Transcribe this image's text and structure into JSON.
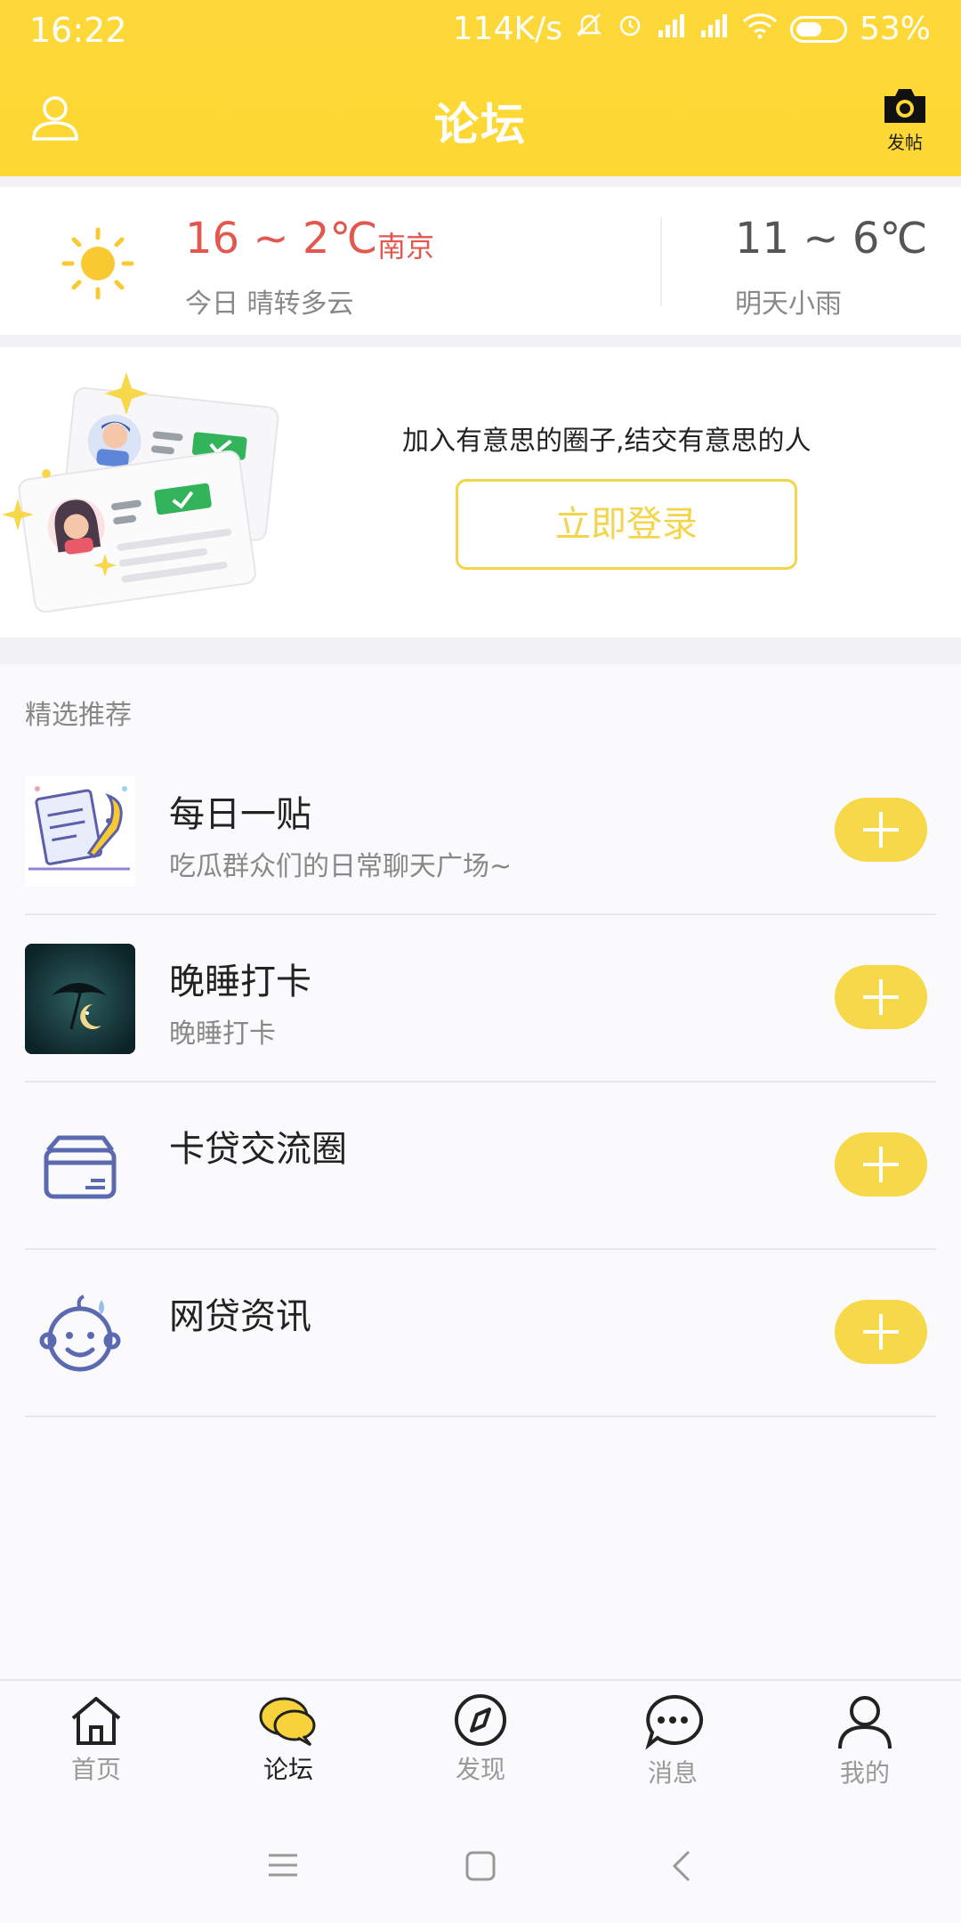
{
  "status": {
    "time": "16:22",
    "speed": "114K/s",
    "battery": "53%"
  },
  "header": {
    "title": "论坛",
    "post_label": "发帖"
  },
  "weather": {
    "today_temp": "16 ~ 2℃",
    "city": "南京",
    "today_desc": "今日 晴转多云",
    "tomorrow_temp": "11 ~ 6℃",
    "tomorrow_desc": "明天小雨"
  },
  "promo": {
    "text": "加入有意思的圈子,结交有意思的人",
    "login_label": "立即登录"
  },
  "recommend": {
    "heading": "精选推荐",
    "items": [
      {
        "name": "每日一贴",
        "desc": "吃瓜群众们的日常聊天广场~"
      },
      {
        "name": "晚睡打卡",
        "desc": "晚睡打卡"
      },
      {
        "name": "卡贷交流圈",
        "desc": ""
      },
      {
        "name": "网贷资讯",
        "desc": ""
      }
    ]
  },
  "tabs": [
    {
      "label": "首页",
      "icon": "home-icon"
    },
    {
      "label": "论坛",
      "icon": "forum-icon"
    },
    {
      "label": "发现",
      "icon": "compass-icon"
    },
    {
      "label": "消息",
      "icon": "message-icon"
    },
    {
      "label": "我的",
      "icon": "profile-icon"
    }
  ],
  "colors": {
    "brand_yellow": "#fdd835",
    "accent_red": "#e2584f",
    "icon_blue": "#5b6ab0"
  }
}
